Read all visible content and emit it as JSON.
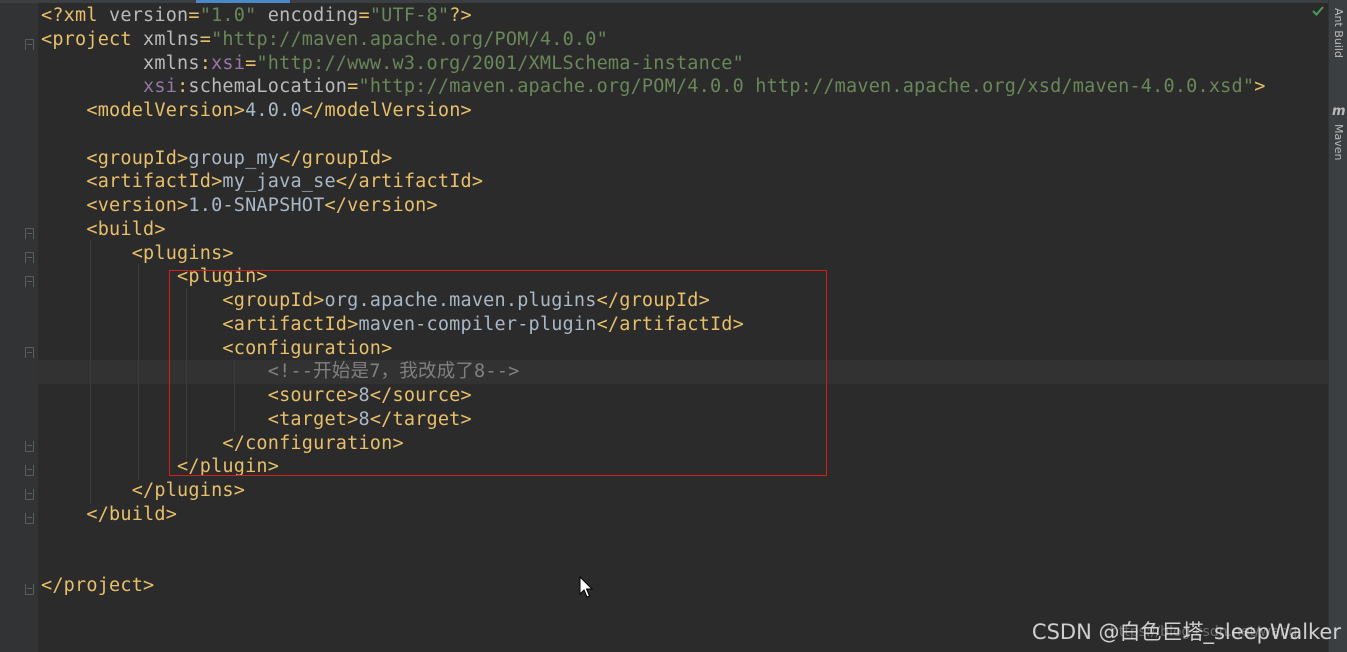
{
  "editor": {
    "lines": [
      [
        {
          "c": "tag",
          "t": "<?xml "
        },
        {
          "c": "attr",
          "t": "version"
        },
        {
          "c": "tag",
          "t": "="
        },
        {
          "c": "str",
          "t": "\"1.0\""
        },
        {
          "c": "attr",
          "t": " encoding"
        },
        {
          "c": "tag",
          "t": "="
        },
        {
          "c": "str",
          "t": "\"UTF-8\""
        },
        {
          "c": "tag",
          "t": "?>"
        }
      ],
      [
        {
          "c": "tag",
          "t": "<project "
        },
        {
          "c": "attr",
          "t": "xmlns"
        },
        {
          "c": "tag",
          "t": "="
        },
        {
          "c": "str",
          "t": "\"http://maven.apache.org/POM/4.0.0\""
        }
      ],
      [
        {
          "c": "attr",
          "t": "         xmlns"
        },
        {
          "c": "tag",
          "t": ":"
        },
        {
          "c": "ns",
          "t": "xsi"
        },
        {
          "c": "tag",
          "t": "="
        },
        {
          "c": "str",
          "t": "\"http://www.w3.org/2001/XMLSchema-instance\""
        }
      ],
      [
        {
          "c": "ns",
          "t": "         xsi"
        },
        {
          "c": "tag",
          "t": ":"
        },
        {
          "c": "attr",
          "t": "schemaLocation"
        },
        {
          "c": "tag",
          "t": "="
        },
        {
          "c": "str",
          "t": "\"http://maven.apache.org/POM/4.0.0 http://maven.apache.org/xsd/maven-4.0.0.xsd\""
        },
        {
          "c": "tag",
          "t": ">"
        }
      ],
      [
        {
          "c": "tag",
          "t": "    <modelVersion>"
        },
        {
          "c": "txt",
          "t": "4.0.0"
        },
        {
          "c": "tag",
          "t": "</modelVersion>"
        }
      ],
      [],
      [
        {
          "c": "tag",
          "t": "    <groupId>"
        },
        {
          "c": "txt",
          "t": "group_my"
        },
        {
          "c": "tag",
          "t": "</groupId>"
        }
      ],
      [
        {
          "c": "tag",
          "t": "    <artifactId>"
        },
        {
          "c": "txt",
          "t": "my_java_se"
        },
        {
          "c": "tag",
          "t": "</artifactId>"
        }
      ],
      [
        {
          "c": "tag",
          "t": "    <version>"
        },
        {
          "c": "txt",
          "t": "1.0-SNAPSHOT"
        },
        {
          "c": "tag",
          "t": "</version>"
        }
      ],
      [
        {
          "c": "tag",
          "t": "    <build>"
        }
      ],
      [
        {
          "c": "tag",
          "t": "        <plugins>"
        }
      ],
      [
        {
          "c": "tag",
          "t": "            <plugin>"
        }
      ],
      [
        {
          "c": "tag",
          "t": "                <groupId>"
        },
        {
          "c": "txt",
          "t": "org.apache.maven.plugins"
        },
        {
          "c": "tag",
          "t": "</groupId>"
        }
      ],
      [
        {
          "c": "tag",
          "t": "                <artifactId>"
        },
        {
          "c": "txt",
          "t": "maven-compiler-plugin"
        },
        {
          "c": "tag",
          "t": "</artifactId>"
        }
      ],
      [
        {
          "c": "tag",
          "t": "                <configuration>"
        }
      ],
      [
        {
          "c": "cmt",
          "t": "                    <!--开始是7，我改成了8-->"
        }
      ],
      [
        {
          "c": "tag",
          "t": "                    <source>"
        },
        {
          "c": "txt",
          "t": "8"
        },
        {
          "c": "tag",
          "t": "</source>"
        }
      ],
      [
        {
          "c": "tag",
          "t": "                    <target>"
        },
        {
          "c": "txt",
          "t": "8"
        },
        {
          "c": "tag",
          "t": "</target>"
        }
      ],
      [
        {
          "c": "tag",
          "t": "                </configuration>"
        }
      ],
      [
        {
          "c": "tag",
          "t": "            </plugin>"
        }
      ],
      [
        {
          "c": "tag",
          "t": "        </plugins>"
        }
      ],
      [
        {
          "c": "tag",
          "t": "    </build>"
        }
      ],
      [],
      [],
      [
        {
          "c": "tag",
          "t": "</project>"
        }
      ]
    ]
  },
  "right_panel": {
    "ant_build_label": "Ant Build",
    "maven_label": "Maven",
    "maven_glyph": "m"
  },
  "watermark": {
    "text": "CSDN @白色巨塔_sleepWalker",
    "url_fragment": "https://blog.csdn.net/wang"
  },
  "colors": {
    "background": "#2b2b2b",
    "gutter": "#313335",
    "tag": "#e8bf6a",
    "attribute": "#bababa",
    "namespace": "#9876aa",
    "string": "#6a8759",
    "text": "#a9b7c6",
    "comment": "#808080",
    "highlight_border": "#d0201c",
    "check": "#499c54"
  },
  "icons": {
    "status": "check-icon",
    "pointer": "mouse-cursor-icon",
    "fold": "fold-marker-icon"
  }
}
